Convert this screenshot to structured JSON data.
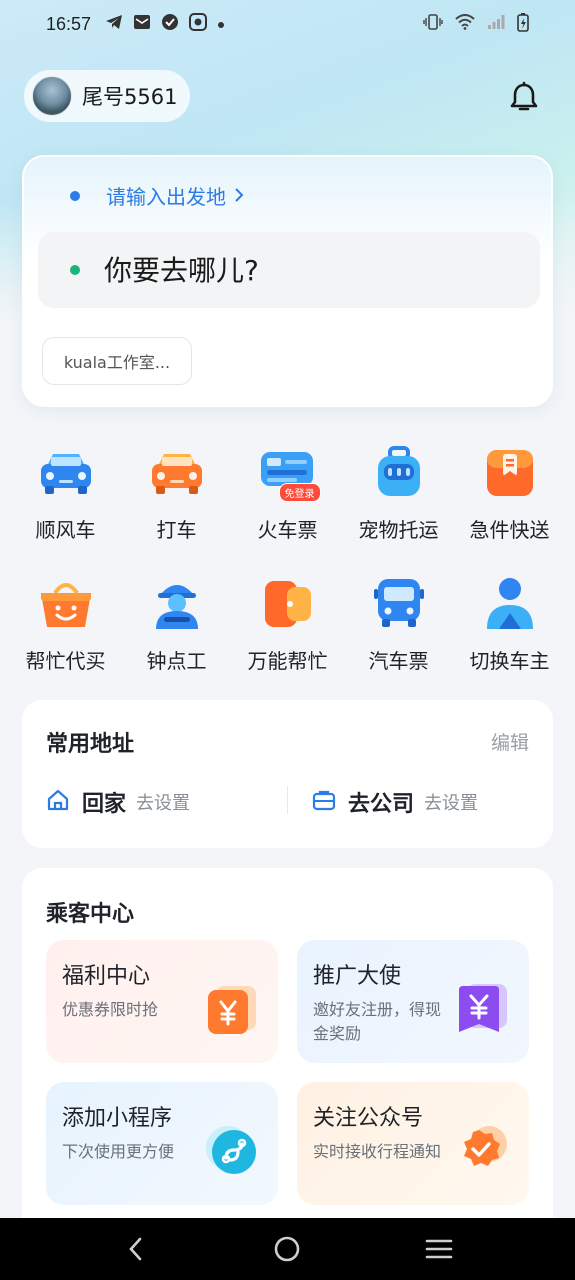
{
  "status_bar": {
    "time": "16:57",
    "left_icons": [
      "telegram-icon",
      "mail-icon",
      "check-circle-icon",
      "gallery-icon",
      "dot-icon"
    ],
    "right_icons": [
      "vibrate-icon",
      "wifi-icon",
      "signal-icon",
      "battery-charging-icon"
    ]
  },
  "header": {
    "account_label": "尾号5561",
    "notification_icon": "bell-icon"
  },
  "search": {
    "origin_prompt": "请输入出发地",
    "destination_placeholder": "你要去哪儿?",
    "recent_place": "kuala工作室..."
  },
  "services": [
    {
      "label": "顺风车",
      "icon": "carpool-car-icon"
    },
    {
      "label": "打车",
      "icon": "taxi-icon"
    },
    {
      "label": "火车票",
      "icon": "train-ticket-icon",
      "badge": "免登录"
    },
    {
      "label": "宠物托运",
      "icon": "pet-carrier-icon"
    },
    {
      "label": "急件快送",
      "icon": "express-delivery-icon"
    },
    {
      "label": "帮忙代买",
      "icon": "shopping-basket-icon"
    },
    {
      "label": "钟点工",
      "icon": "worker-icon"
    },
    {
      "label": "万能帮忙",
      "icon": "helper-icon"
    },
    {
      "label": "汽车票",
      "icon": "bus-icon"
    },
    {
      "label": "切换车主",
      "icon": "switch-driver-icon"
    }
  ],
  "addresses": {
    "title": "常用地址",
    "edit_label": "编辑",
    "home": {
      "name": "回家",
      "action": "去设置"
    },
    "work": {
      "name": "去公司",
      "action": "去设置"
    }
  },
  "passenger_center": {
    "title": "乘客中心",
    "tiles": [
      {
        "title": "福利中心",
        "subtitle": "优惠券限时抢",
        "icon": "coupon-yen-icon"
      },
      {
        "title": "推广大使",
        "subtitle": "邀好友注册，得现金奖励",
        "icon": "reward-yen-icon"
      },
      {
        "title": "添加小程序",
        "subtitle": "下次使用更方便",
        "icon": "mini-program-icon"
      },
      {
        "title": "关注公众号",
        "subtitle": "实时接收行程通知",
        "icon": "verified-badge-icon"
      }
    ]
  },
  "colors": {
    "accent_blue": "#2d7be5",
    "origin_dot": "#2d7be5",
    "destination_dot": "#1db37b"
  }
}
